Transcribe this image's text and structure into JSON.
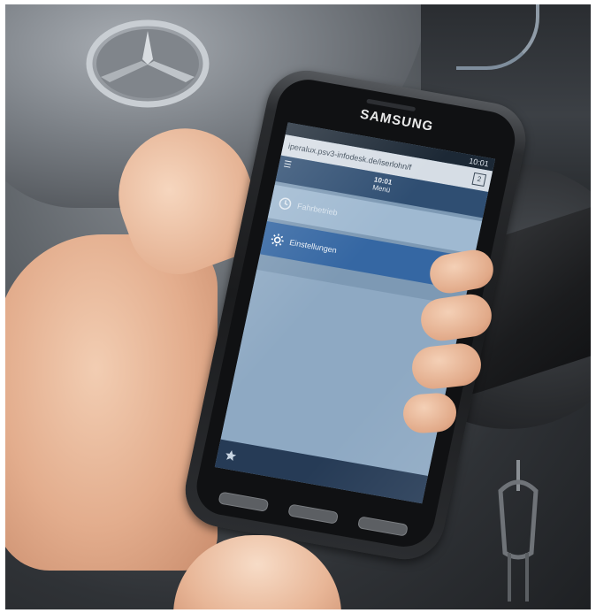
{
  "phone": {
    "brand": "SAMSUNG",
    "status_time": "10:01",
    "url": "iperalux.psv3-infodesk.de/iserlohn/f",
    "tab_count": "2"
  },
  "app": {
    "header_time": "10:01",
    "header_title": "Menü",
    "menu_items": [
      {
        "label": "Fahrbetrieb",
        "icon": "clock-icon"
      },
      {
        "label": "Einstellungen",
        "icon": "gear-icon"
      }
    ],
    "bottom_icon": "star-icon"
  },
  "scene": {
    "car_logo": "mercedes-star-logo",
    "colors": {
      "app_header": "#2f4e72",
      "selected_item": "#3567a3",
      "screen_background": "#8ea9c3"
    }
  }
}
